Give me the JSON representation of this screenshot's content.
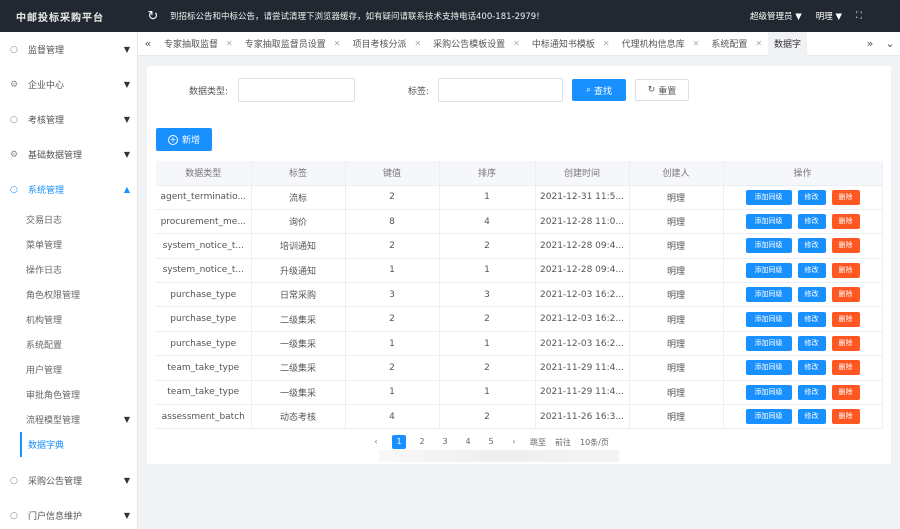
{
  "app": {
    "title": "中邮投标采购平台"
  },
  "topbar": {
    "notice": "到招标公告和中标公告，请尝试清理下浏览器缓存，如有疑问请联系技术支持电话400-181-2979!",
    "role": "超级管理员 ▼",
    "user": "明理 ▼",
    "fullscreen": "⛶"
  },
  "sidebar": {
    "items": [
      {
        "label": "监督管理",
        "icon": "○"
      },
      {
        "label": "企业中心",
        "icon": "⚙"
      },
      {
        "label": "考核管理",
        "icon": "○"
      },
      {
        "label": "基础数据管理",
        "icon": "⚙"
      },
      {
        "label": "系统管理",
        "icon": "○"
      }
    ],
    "sub": [
      {
        "label": "交易日志"
      },
      {
        "label": "菜单管理"
      },
      {
        "label": "操作日志"
      },
      {
        "label": "角色权限管理"
      },
      {
        "label": "机构管理"
      },
      {
        "label": "系统配置"
      },
      {
        "label": "用户管理"
      },
      {
        "label": "审批角色管理"
      },
      {
        "label": "流程模型管理"
      },
      {
        "label": "数据字典"
      }
    ],
    "after": [
      {
        "label": "采购公告管理",
        "icon": "○"
      },
      {
        "label": "门户信息维护",
        "icon": "○"
      }
    ]
  },
  "tabs": {
    "prev": "«",
    "next": "»",
    "more": "⌄",
    "items": [
      {
        "label": "专家抽取监督"
      },
      {
        "label": "专家抽取监督员设置"
      },
      {
        "label": "项目考核分派"
      },
      {
        "label": "采购公告模板设置"
      },
      {
        "label": "中标通知书模板"
      },
      {
        "label": "代理机构信息库"
      },
      {
        "label": "系统配置"
      },
      {
        "label": "数据字"
      }
    ]
  },
  "filter": {
    "type_label": "数据类型:",
    "type_value": "",
    "tag_label": "标签:",
    "tag_value": "",
    "search": "查找",
    "reset": "重置"
  },
  "toolbar": {
    "add": "新增"
  },
  "table": {
    "headers": [
      "数据类型",
      "标签",
      "键值",
      "排序",
      "创建时间",
      "创建人",
      "操作"
    ],
    "actions": {
      "add_sub": "添加同级",
      "edit": "修改",
      "delete": "删除"
    },
    "rows": [
      {
        "type": "agent_terminatio...",
        "label": "流标",
        "value": "2",
        "sort": "1",
        "created": "2021-12-31 11:5...",
        "creator": "明理"
      },
      {
        "type": "procurement_me...",
        "label": "询价",
        "value": "8",
        "sort": "4",
        "created": "2021-12-28 11:0...",
        "creator": "明理"
      },
      {
        "type": "system_notice_t...",
        "label": "培训通知",
        "value": "2",
        "sort": "2",
        "created": "2021-12-28 09:4...",
        "creator": "明理"
      },
      {
        "type": "system_notice_t...",
        "label": "升级通知",
        "value": "1",
        "sort": "1",
        "created": "2021-12-28 09:4...",
        "creator": "明理"
      },
      {
        "type": "purchase_type",
        "label": "日常采购",
        "value": "3",
        "sort": "3",
        "created": "2021-12-03 16:2...",
        "creator": "明理"
      },
      {
        "type": "purchase_type",
        "label": "二级集采",
        "value": "2",
        "sort": "2",
        "created": "2021-12-03 16:2...",
        "creator": "明理"
      },
      {
        "type": "purchase_type",
        "label": "一级集采",
        "value": "1",
        "sort": "1",
        "created": "2021-12-03 16:2...",
        "creator": "明理"
      },
      {
        "type": "team_take_type",
        "label": "二级集采",
        "value": "2",
        "sort": "2",
        "created": "2021-11-29 11:4...",
        "creator": "明理"
      },
      {
        "type": "team_take_type",
        "label": "一级集采",
        "value": "1",
        "sort": "1",
        "created": "2021-11-29 11:4...",
        "creator": "明理"
      },
      {
        "type": "assessment_batch",
        "label": "动态考核",
        "value": "4",
        "sort": "2",
        "created": "2021-11-26 16:3...",
        "creator": "明理"
      }
    ]
  },
  "pager": {
    "prev": "‹",
    "pages": [
      "1",
      "2",
      "3",
      "4",
      "5"
    ],
    "current": "1",
    "next": "›",
    "goto": "跳至",
    "jump": "前往",
    "size": "10条/页"
  },
  "colors": {
    "primary": "#1890ff",
    "danger": "#ff5722",
    "topbar": "#222831"
  }
}
